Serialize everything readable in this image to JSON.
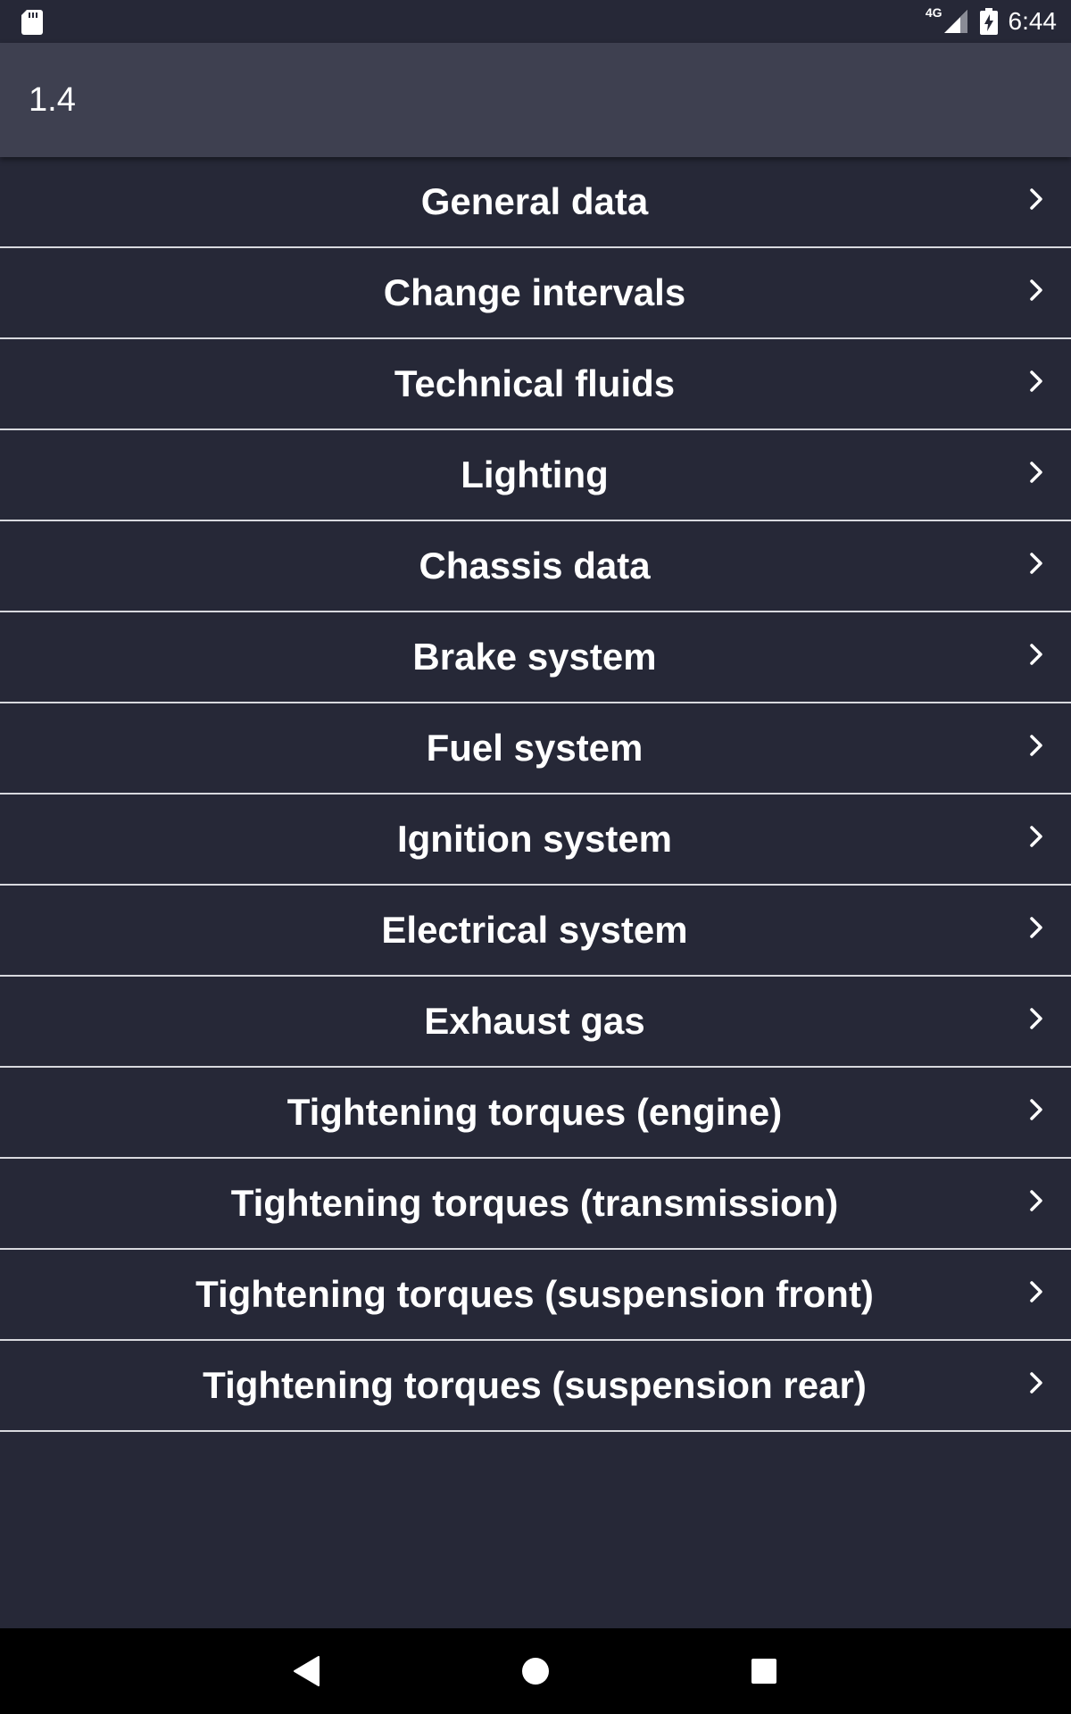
{
  "status_bar": {
    "network_type": "4G",
    "time": "6:44",
    "icons": [
      "sd-card-icon",
      "signal-icon",
      "battery-charging-icon"
    ]
  },
  "app_bar": {
    "title": "1.4"
  },
  "menu": {
    "items": [
      {
        "label": "General data"
      },
      {
        "label": "Change intervals"
      },
      {
        "label": "Technical fluids"
      },
      {
        "label": "Lighting"
      },
      {
        "label": "Chassis data"
      },
      {
        "label": "Brake system"
      },
      {
        "label": "Fuel system"
      },
      {
        "label": "Ignition system"
      },
      {
        "label": "Electrical system"
      },
      {
        "label": "Exhaust gas"
      },
      {
        "label": "Tightening torques (engine)"
      },
      {
        "label": "Tightening torques (transmission)"
      },
      {
        "label": "Tightening torques (suspension front)"
      },
      {
        "label": "Tightening torques (suspension rear)"
      }
    ],
    "item_icon": "chevron-right-icon"
  },
  "nav_bar": {
    "buttons": [
      "back-icon",
      "home-icon",
      "recents-icon"
    ]
  },
  "colors": {
    "background": "#262837",
    "app_bar": "#3e4050",
    "divider": "#d8d9de",
    "text": "#ffffff",
    "nav_bar": "#000000"
  }
}
